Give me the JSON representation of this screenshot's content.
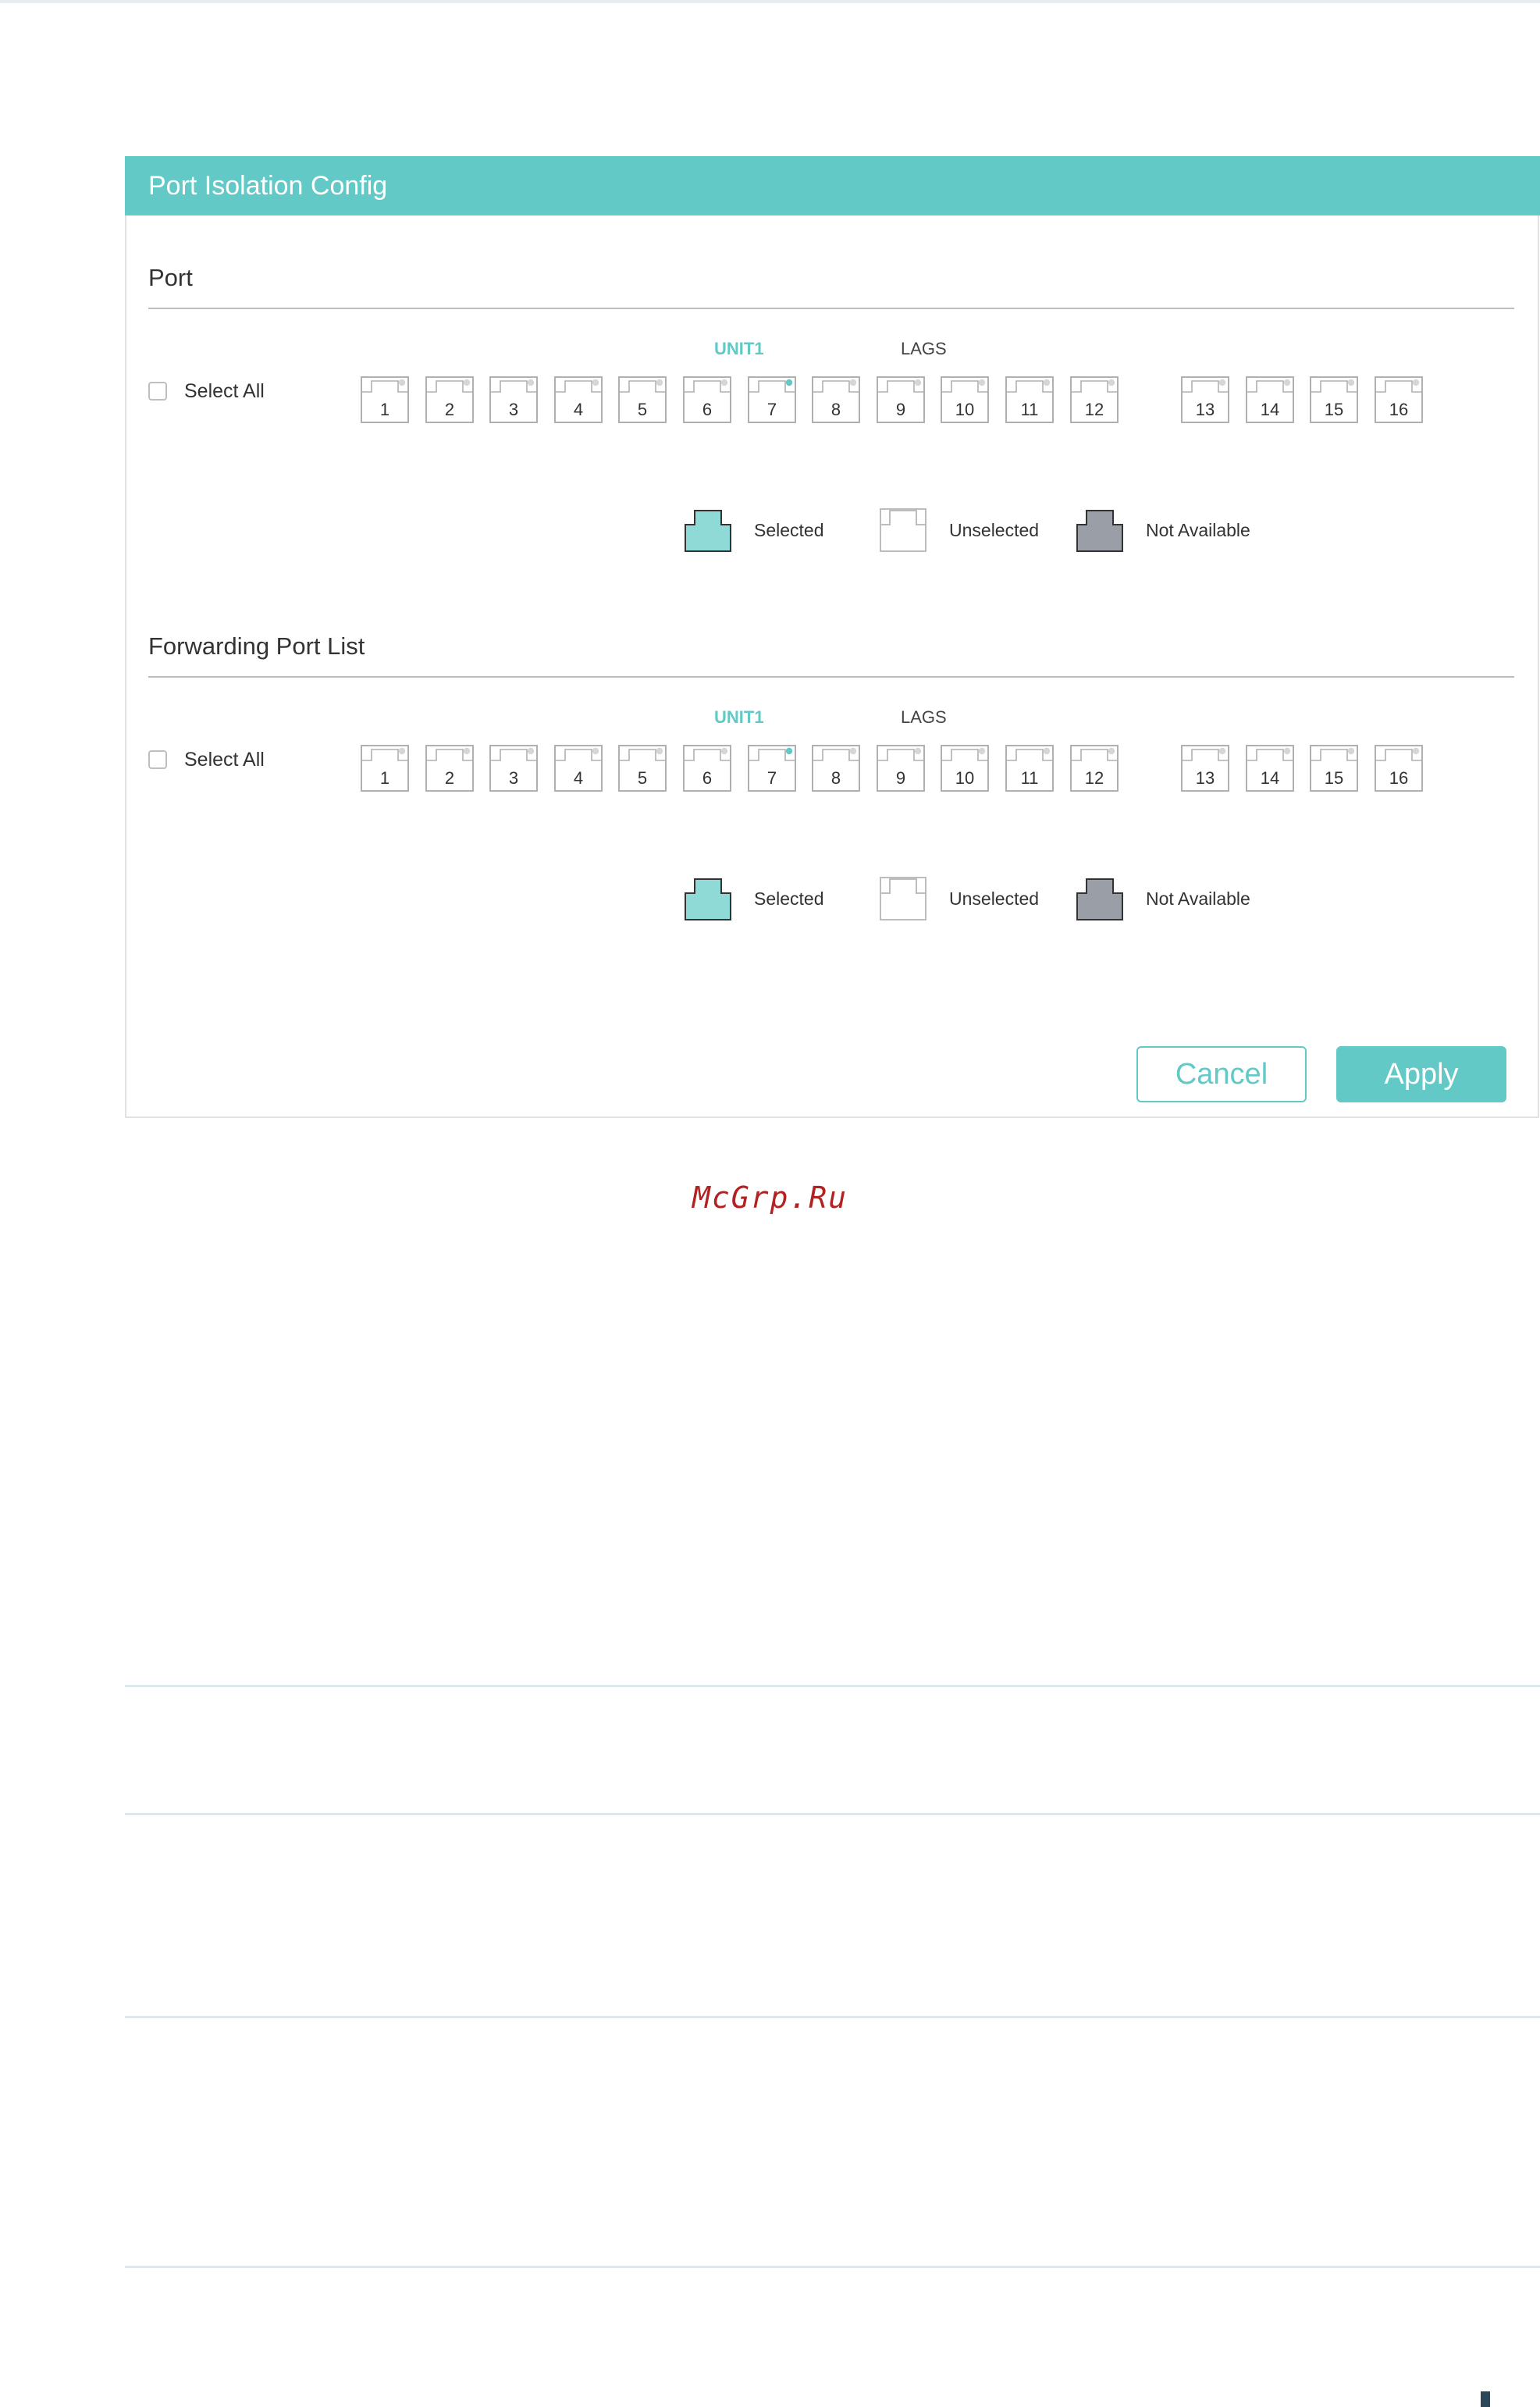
{
  "panel": {
    "title": "Port Isolation Config"
  },
  "sections": {
    "port": {
      "title": "Port",
      "unit_label": "UNIT1",
      "lags_label": "LAGS",
      "select_all": "Select All"
    },
    "forwarding": {
      "title": "Forwarding Port List",
      "unit_label": "UNIT1",
      "lags_label": "LAGS",
      "select_all": "Select All"
    }
  },
  "ports": [
    "1",
    "2",
    "3",
    "4",
    "5",
    "6",
    "7",
    "8",
    "9",
    "10",
    "11",
    "12",
    "13",
    "14",
    "15",
    "16"
  ],
  "active_indicator_port": "7",
  "legend": {
    "selected": "Selected",
    "unselected": "Unselected",
    "not_available": "Not Available"
  },
  "buttons": {
    "cancel": "Cancel",
    "apply": "Apply"
  },
  "watermark": "McGrp.Ru",
  "colors": {
    "accent": "#62c9c6",
    "selected_fill": "#8fd9d6",
    "not_available_fill": "#9a9ea6",
    "port_border": "#b0b0b0",
    "watermark": "#b22222"
  }
}
